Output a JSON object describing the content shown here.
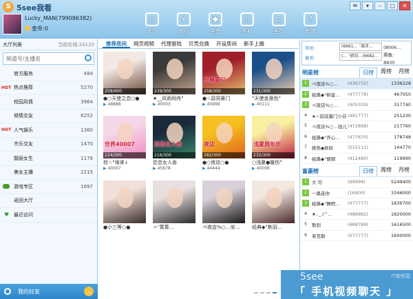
{
  "app": {
    "title": "5see我看",
    "logo_char": "S"
  },
  "window_buttons": [
    "✉",
    "▾",
    "–",
    "□",
    "✕"
  ],
  "user": {
    "name": "Lucky_MAN(799086382)",
    "coins_label": "金币:0"
  },
  "nav": [
    {
      "label": "大厅",
      "icon": "hall-icon",
      "glyph": "⌂"
    },
    {
      "label": "银行",
      "icon": "bank-icon",
      "glyph": "¥"
    },
    {
      "label": "充值",
      "icon": "diamond-icon",
      "glyph": "◆"
    },
    {
      "label": "手机",
      "icon": "phone-icon",
      "glyph": "▯"
    },
    {
      "label": "主页",
      "icon": "home-icon",
      "glyph": "⌂"
    },
    {
      "label": "帮助",
      "icon": "help-icon",
      "glyph": "?"
    }
  ],
  "sidebar": {
    "header_label": "大厅列表",
    "online_label": "当前在线:",
    "online_count": "24120",
    "search_placeholder": "频道号/主播名",
    "items": [
      {
        "label": "官方服务",
        "count": "484",
        "badge": ""
      },
      {
        "label": "热点推荐",
        "count": "5270",
        "badge": "HOT"
      },
      {
        "label": "校园风情",
        "count": "3964",
        "badge": ""
      },
      {
        "label": "倾情交友",
        "count": "6252",
        "badge": ""
      },
      {
        "label": "人气娱乐",
        "count": "1360",
        "badge": "HOT"
      },
      {
        "label": "齐乐交友",
        "count": "1470",
        "badge": ""
      },
      {
        "label": "靓丽女生",
        "count": "1178",
        "badge": ""
      },
      {
        "label": "美女主播",
        "count": "2215",
        "badge": ""
      },
      {
        "label": "游戏专区",
        "count": "1897",
        "badge": "game"
      },
      {
        "label": "返回大厅",
        "count": "",
        "badge": ""
      },
      {
        "label": "最近访问",
        "count": "",
        "badge": "heart"
      }
    ],
    "friends_label": "我的好友"
  },
  "tabs": [
    "推荐房间",
    "网页视频",
    "代理登陆",
    "贝壳兑换",
    "开设房间",
    "新手上路"
  ],
  "rooms": [
    {
      "viewers": "259/400",
      "name": "●○天使之恋○●",
      "id": "48888",
      "colors": [
        "#f3e8e4",
        "#6a4a3a"
      ],
      "overlay": ""
    },
    {
      "viewers": "239/300",
      "name": "★__风雨同舟°",
      "id": "40003",
      "colors": [
        "#3a3a3a",
        "#c8a890"
      ],
      "overlay": ""
    },
    {
      "viewers": "258/300",
      "name": "●☆窈窕豪门",
      "id": "40999",
      "colors": [
        "#a0202a",
        "#e8c070"
      ],
      "overlay": "至尊豪门"
    },
    {
      "viewers": "231/300",
      "name": "°天使金莲色°",
      "id": "40111",
      "colors": [
        "#1b4f8a",
        "#f2d0b0"
      ],
      "overlay": ""
    },
    {
      "viewers": "224/300",
      "name": "校☆°缘来↓",
      "id": "40007",
      "colors": [
        "#f5d8e8",
        "#f28ac0"
      ],
      "overlay": "世界40007"
    },
    {
      "viewers": "216/300",
      "name": "恋恋女人香",
      "id": "45678",
      "colors": [
        "#1a2a3a",
        "#3a8a6a"
      ],
      "overlay": "恋恋女人香"
    },
    {
      "viewers": "282/300",
      "name": "●○夜店○●",
      "id": "44444",
      "colors": [
        "#f5c020",
        "#e06020"
      ],
      "overlay": "夜店"
    },
    {
      "viewers": "232/300",
      "name": "○浅夏●暖伤°",
      "id": "40006",
      "colors": [
        "#f8f0a0",
        "#c02040"
      ],
      "overlay": "浅夏周年庆"
    },
    {
      "viewers": "",
      "name": "●小三等○●",
      "id": "",
      "colors": [
        "#f0e0d8",
        "#3a2a2a"
      ],
      "overlay": ""
    },
    {
      "viewers": "",
      "name": "〃″菁菁…",
      "id": "",
      "colors": [
        "#e8e0e0",
        "#2a2a2a"
      ],
      "overlay": ""
    },
    {
      "viewers": "",
      "name": "ペ夜店%○…安…",
      "id": "",
      "colors": [
        "#d8d0d8",
        "#1a1a1a"
      ],
      "overlay": ""
    },
    {
      "viewers": "",
      "name": "经典◆°荆羽…",
      "id": "",
      "colors": [
        "#f2e8e0",
        "#4a2a2a"
      ],
      "overlay": ""
    }
  ],
  "city": {
    "city_label": "市长:",
    "city_value": "(6661… ″海洋…",
    "county_label": "县长:",
    "county_value": "(… ″抓日…(6682…",
    "crowd_value": "(8006…",
    "ticket_label": "票数:",
    "ticket_value": "8830"
  },
  "star_rank": {
    "title": "明星榜",
    "tabs": [
      "日榜",
      "周榜",
      "月榜"
    ],
    "rows": [
      {
        "rank": "1",
        "name": "ペ夜店%○…",
        "id": "(436752)",
        "value": "1336228"
      },
      {
        "rank": "2",
        "name": "经典◆°柳金…",
        "id": "(477778)",
        "value": "467050"
      },
      {
        "rank": "3",
        "name": "ペ夜店%○…",
        "id": "(405329)",
        "value": "317740"
      },
      {
        "rank": "4",
        "name": "★☆窈窕豪门小芬",
        "id": "(491777)",
        "value": "251230"
      },
      {
        "rank": "5",
        "name": "ペ夜店%○…钱儿",
        "id": "(472899)",
        "value": "217760"
      },
      {
        "rank": "6",
        "name": "经典◆°开心…",
        "id": "(477670)",
        "value": "178748"
      },
      {
        "rank": "7",
        "name": "绝色◆妖妖",
        "id": "(515111)",
        "value": "144770"
      },
      {
        "rank": "8",
        "name": "经典◆°丽丽",
        "id": "(412480)",
        "value": "119990"
      }
    ]
  },
  "rich_rank": {
    "title": "富豪榜",
    "tabs": [
      "日榜",
      "周榜",
      "月榜"
    ],
    "rows": [
      {
        "rank": "1",
        "name": "大 司",
        "id": "(99999)",
        "value": "5249400"
      },
      {
        "rank": "2",
        "name": "一路走你",
        "id": "(16900)",
        "value": "3346000"
      },
      {
        "rank": "3",
        "name": "经典◆°舞吧…",
        "id": "(477777)",
        "value": "1839700"
      },
      {
        "rank": "4",
        "name": "★.._.(^…",
        "id": "(488882)",
        "value": "1820000"
      },
      {
        "rank": "5",
        "name": "歌到",
        "id": "(688789)",
        "value": "1616500"
      },
      {
        "rank": "6",
        "name": "老克勒",
        "id": "(577777)",
        "value": "1600000"
      }
    ]
  },
  "banner": {
    "line1": "5see",
    "line2": "「 手机视频聊天 」",
    "watermark": "IT软件园"
  },
  "pager_dots": 4
}
